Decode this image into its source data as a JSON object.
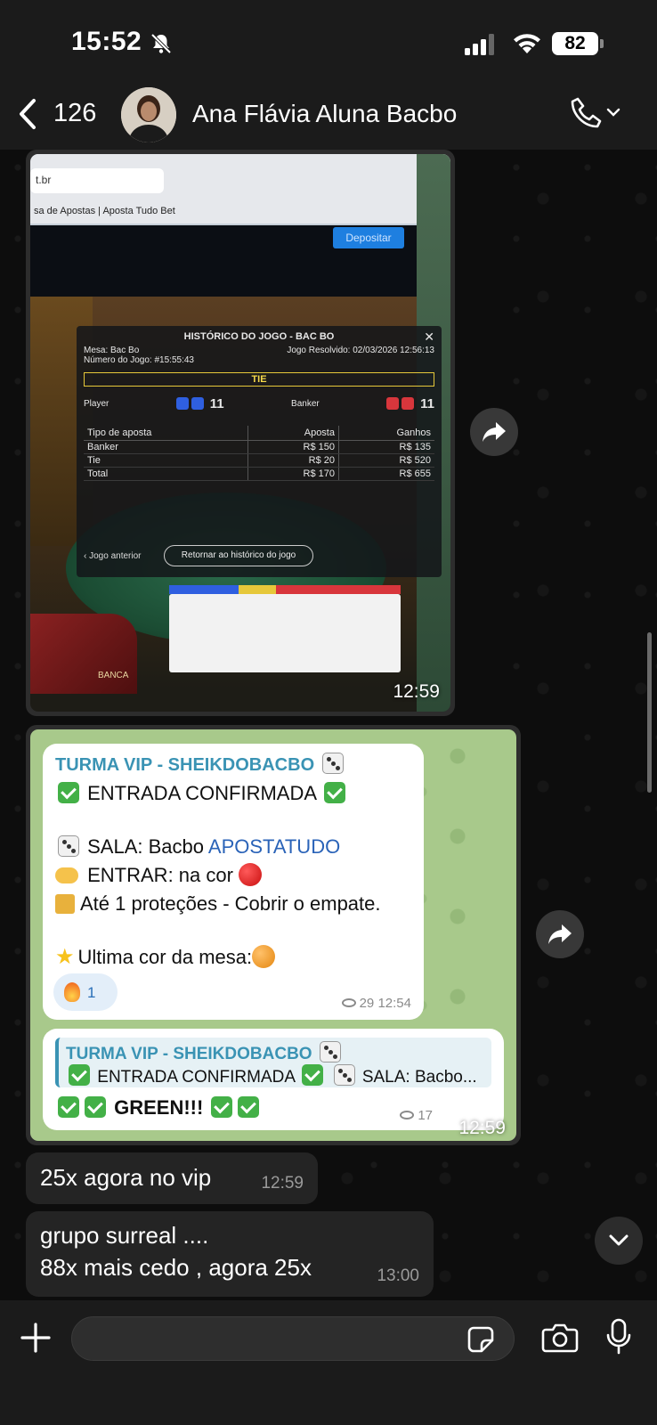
{
  "status_bar": {
    "time": "15:52",
    "battery": "82"
  },
  "header": {
    "back_count": "126",
    "contact_name": "Ana Flávia Aluna Bacbo"
  },
  "image_message": {
    "browser": {
      "url": "t.br",
      "site_title": "sa de Apostas | Aposta Tudo Bet",
      "deposit_button": "Depositar"
    },
    "history": {
      "title": "HISTÓRICO DO JOGO - BAC BO",
      "table_name": "Mesa: Bac Bo",
      "game_number": "Número do Jogo: #15:55:43",
      "resolved": "Jogo Resolvido: 02/03/2026 12:56:13",
      "result": "TIE",
      "player_label": "Player",
      "player_score": "11",
      "banker_label": "Banker",
      "banker_score": "11",
      "columns": [
        "Tipo de aposta",
        "Aposta",
        "Ganhos"
      ],
      "rows": [
        [
          "Banker",
          "R$ 150",
          "R$ 135"
        ],
        [
          "Tie",
          "R$ 20",
          "R$ 520"
        ],
        [
          "Total",
          "R$ 170",
          "R$ 655"
        ]
      ],
      "prev_game": "Jogo anterior",
      "return_button": "Retornar ao histórico do jogo",
      "banca_label": "BANCA"
    },
    "time": "12:59"
  },
  "forwarded_message": {
    "post": {
      "channel": "TURMA VIP - SHEIKDOBACBO",
      "line1": "ENTRADA CONFIRMADA",
      "line2_prefix": "SALA: Bacbo ",
      "line2_link": "APOSTATUDO",
      "line3": "ENTRAR: na cor",
      "line4": "Até 1 proteções - Cobrir o empate.",
      "line5": "Ultima cor da mesa:",
      "reaction_count": "1",
      "views": "29",
      "time": "12:54"
    },
    "reply": {
      "quote_channel": "TURMA VIP - SHEIKDOBACBO",
      "quote_text": "ENTRADA CONFIRMADA",
      "quote_suffix": "SALA: Bacbo...",
      "text": "GREEN!!!",
      "views": "17"
    },
    "time": "12:59"
  },
  "messages": [
    {
      "text": "25x agora no vip",
      "time": "12:59"
    },
    {
      "line1": "grupo surreal ....",
      "line2": "88x mais cedo , agora 25x",
      "time": "13:00"
    }
  ],
  "input": {
    "placeholder": "",
    "value": ""
  },
  "colors": {
    "bubble": "#242424",
    "header": "#1b1b1b",
    "tg_green_bg": "#a8c98b",
    "tg_accent": "#3a93b4",
    "deposit": "#1e7fe0"
  }
}
